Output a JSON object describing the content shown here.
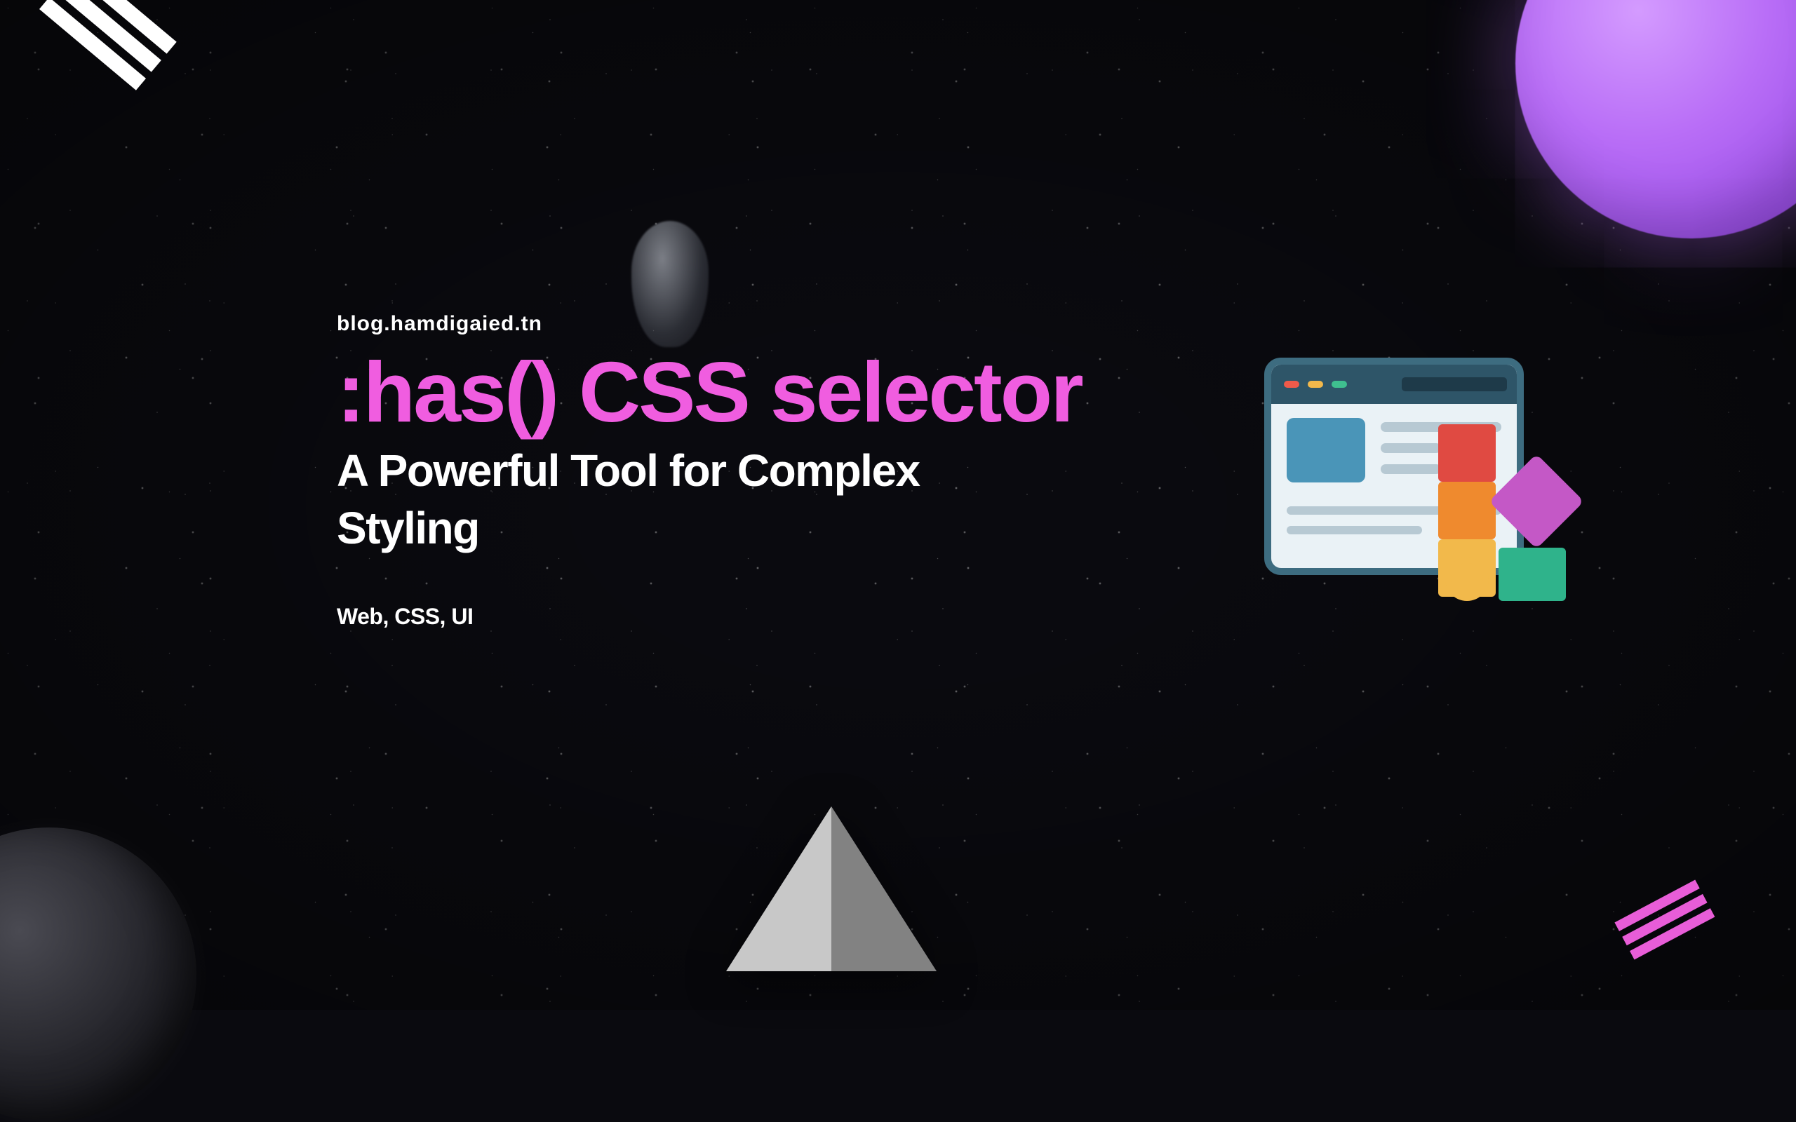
{
  "header": {
    "site_label": "blog.hamdigaied.tn"
  },
  "hero": {
    "title": ":has() CSS selector",
    "subtitle": "A Powerful Tool for Complex Styling",
    "tags": "Web, CSS, UI"
  },
  "colors": {
    "accent_pink": "#f05de0",
    "sphere_purple": "#b96ef7",
    "illus_frame": "#3d6c80",
    "illus_thumb": "#4a95b8",
    "block_red": "#e04a42",
    "block_orange": "#ef8a2e",
    "block_yellow": "#f2b94b",
    "block_teal": "#2fb38b",
    "block_magenta": "#c458c6",
    "background": "#0a0a0f",
    "text_white": "#ffffff"
  }
}
